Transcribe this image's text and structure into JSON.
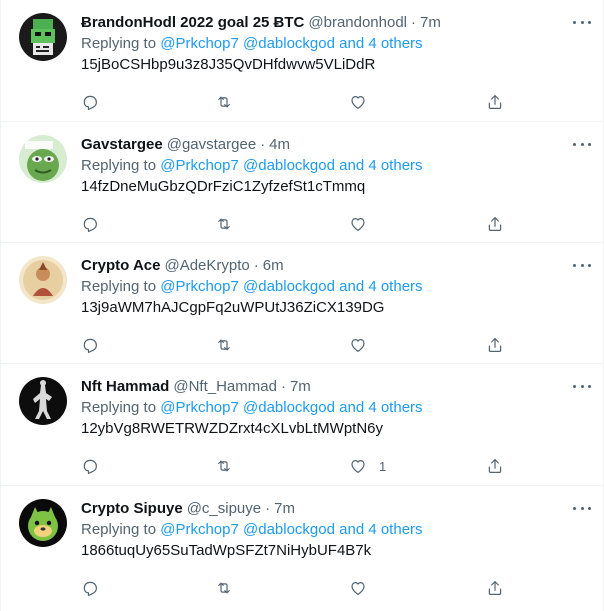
{
  "colors": {
    "link": "#1d9bf0",
    "secondary_text": "#536471",
    "primary_text": "#0f1419",
    "divider": "#eff3f4"
  },
  "icons": {
    "more": "more-horizontal-icon",
    "reply": "reply-icon",
    "retweet": "retweet-icon",
    "like": "heart-icon",
    "share": "share-icon"
  },
  "tweets": [
    {
      "name": "ɃrandonHodl 2022 goal 25 ɃTC",
      "handle": "@brandonhodl",
      "dot": "·",
      "time": "7m",
      "replying_prefix": "Replying to",
      "mention_1": "@Prkchop7",
      "mention_2": "@dablockgod",
      "others": "and 4 others",
      "text": "15jBoCSHbp9u3z8J35QvDHfdwvw5VLiDdR",
      "like_count": ""
    },
    {
      "name": "Gavstargee",
      "handle": "@gavstargee",
      "dot": "·",
      "time": "4m",
      "replying_prefix": "Replying to",
      "mention_1": "@Prkchop7",
      "mention_2": "@dablockgod",
      "others": "and 4 others",
      "text": "14fzDneMuGbzQDrFziC1ZyfzefSt1cTmmq",
      "like_count": ""
    },
    {
      "name": "Crypto Ace",
      "handle": "@AdeKrypto",
      "dot": "·",
      "time": "6m",
      "replying_prefix": "Replying to",
      "mention_1": "@Prkchop7",
      "mention_2": "@dablockgod",
      "others": "and 4 others",
      "text": "13j9aWM7hAJCgpFq2uWPUtJ36ZiCX139DG",
      "like_count": ""
    },
    {
      "name": "Nft Hammad",
      "handle": "@Nft_Hammad",
      "dot": "·",
      "time": "7m",
      "replying_prefix": "Replying to",
      "mention_1": "@Prkchop7",
      "mention_2": "@dablockgod",
      "others": "and 4 others",
      "text": "12ybVg8RWETRWZDZrxt4cXLvbLtMWptN6y",
      "like_count": "1"
    },
    {
      "name": "Crypto Sipuye",
      "handle": "@c_sipuye",
      "dot": "·",
      "time": "7m",
      "replying_prefix": "Replying to",
      "mention_1": "@Prkchop7",
      "mention_2": "@dablockgod",
      "others": "and 4 others",
      "text": "1866tuqUy65SuTadWpSFZt7NiHybUF4B7k",
      "like_count": ""
    }
  ]
}
